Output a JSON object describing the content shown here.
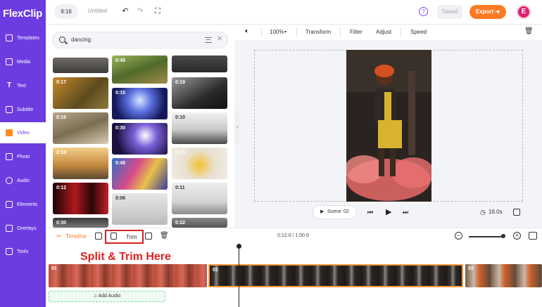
{
  "app": {
    "logo_text": "FlexClip",
    "ratio": "9:16",
    "title": "Untitled",
    "saved_label": "Saved",
    "export_label": "Export ➔",
    "avatar_letter": "E"
  },
  "sidebar": {
    "items": [
      {
        "label": "Templates",
        "icon": "templates-icon"
      },
      {
        "label": "Media",
        "icon": "media-icon"
      },
      {
        "label": "Text",
        "icon": "text-icon"
      },
      {
        "label": "Subtitle",
        "icon": "subtitle-icon"
      },
      {
        "label": "Video",
        "icon": "video-icon",
        "active": true
      },
      {
        "label": "Photo",
        "icon": "photo-icon"
      },
      {
        "label": "Audio",
        "icon": "audio-icon"
      },
      {
        "label": "Elements",
        "icon": "elements-icon"
      },
      {
        "label": "Overlays",
        "icon": "overlays-icon"
      },
      {
        "label": "Tools",
        "icon": "tools-icon"
      }
    ]
  },
  "search": {
    "query": "dancing"
  },
  "media_grid": {
    "durations": [
      "0:45",
      "0:17",
      "0:15",
      "0:19",
      "0:19",
      "0:30",
      "0:10",
      "0:19",
      "0:48",
      "0:15",
      "0:12",
      "0:06",
      "0:11",
      "0:30",
      "0:22"
    ]
  },
  "editor_toolbar": {
    "zoom": "100%",
    "transform": "Transform",
    "filter": "Filter",
    "adjust": "Adjust",
    "speed": "Speed"
  },
  "player": {
    "scene_label": "Scene",
    "scene_number": "02",
    "duration": "16.0s"
  },
  "timeline": {
    "label": "Timeline",
    "trim_label": "Trim",
    "timecode": "0:12.0 / 1:00.0",
    "annotation": "Split & Trim Here",
    "clips": [
      "01",
      "02",
      "03"
    ],
    "add_audio": "Add Audio"
  },
  "colors": {
    "brand": "#6c3ce0",
    "accent": "#ff7a25",
    "annotation": "#e02020"
  }
}
